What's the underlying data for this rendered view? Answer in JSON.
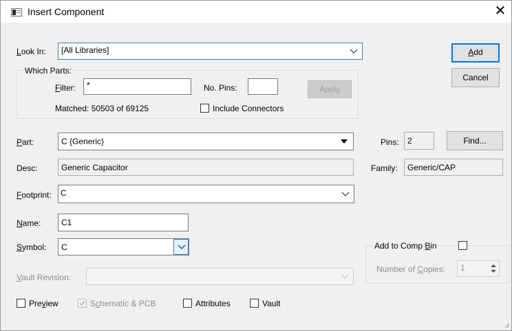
{
  "window": {
    "title": "Insert Component",
    "close_glyph": "✕"
  },
  "look_in": {
    "label_pre": "",
    "label_key": "L",
    "label_post": "ook In:",
    "value": "[All Libraries]"
  },
  "buttons": {
    "add_key": "A",
    "add_rest": "dd",
    "cancel": "Cancel",
    "apply_pre": "Appl",
    "apply_key": "y",
    "find": "Find..."
  },
  "which_parts": {
    "legend": "Which Parts:",
    "filter_key": "F",
    "filter_rest": "ilter:",
    "filter_value": "*",
    "no_pins_label": "No. Pins:",
    "no_pins_value": "",
    "matched": "Matched: 50503 of 69125",
    "include_connectors": "Include Connectors",
    "include_connectors_checked": false
  },
  "part": {
    "label_key": "P",
    "label_rest": "art:",
    "value": "C {Generic}",
    "pins_label": "Pins:",
    "pins_value": "2"
  },
  "desc": {
    "label": "Desc:",
    "value": "Generic Capacitor",
    "family_label": "Family:",
    "family_value": "Generic/CAP"
  },
  "footprint": {
    "label_key": "F",
    "label_rest": "ootprint:",
    "value": "C"
  },
  "name": {
    "label_key": "N",
    "label_rest": "ame:",
    "value": "C1"
  },
  "symbol": {
    "label_key": "S",
    "label_rest": "ymbol:",
    "value": "C"
  },
  "vault_revision": {
    "label_key": "V",
    "label_rest": "ault Revision:",
    "value": ""
  },
  "comp_bin": {
    "label_pre": "Add to Comp ",
    "label_key": "B",
    "label_post": "in",
    "checked": false,
    "copies_pre": "Number of ",
    "copies_key": "C",
    "copies_post": "opies:",
    "copies_value": "1"
  },
  "options": {
    "preview_pre": "Pre",
    "preview_key": "v",
    "preview_post": "iew",
    "preview_checked": false,
    "schematic_pre": "S",
    "schematic_key": "c",
    "schematic_post": "hematic & PCB",
    "schematic_checked": true,
    "attributes": "Attributes",
    "attributes_checked": false,
    "vault": "Vault",
    "vault_checked": false
  },
  "colors": {
    "accent": "#0078d7",
    "disabled_text": "#8d8d8d"
  }
}
